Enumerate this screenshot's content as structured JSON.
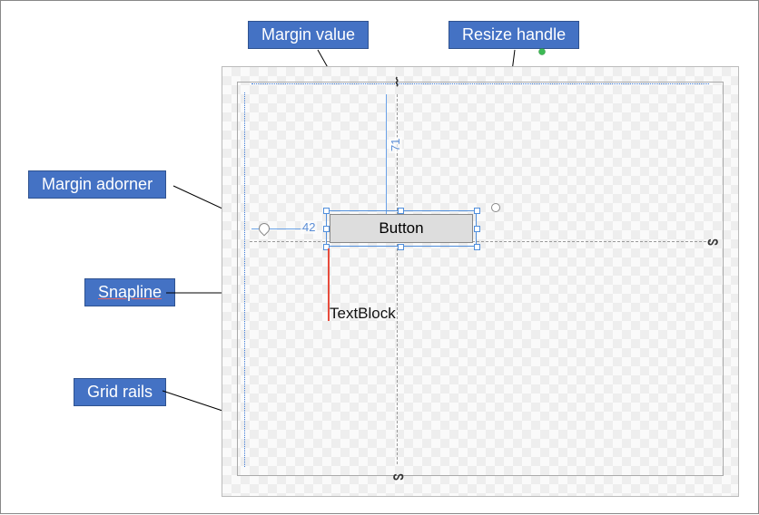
{
  "callouts": {
    "margin_value": "Margin value",
    "resize_handle": "Resize handle",
    "margin_adorner": "Margin adorner",
    "snapline": "Snapline",
    "grid_rails": "Grid rails"
  },
  "designer": {
    "button_label": "Button",
    "textblock_label": "TextBlock",
    "margin_top_value": "71",
    "margin_left_value": "42"
  }
}
